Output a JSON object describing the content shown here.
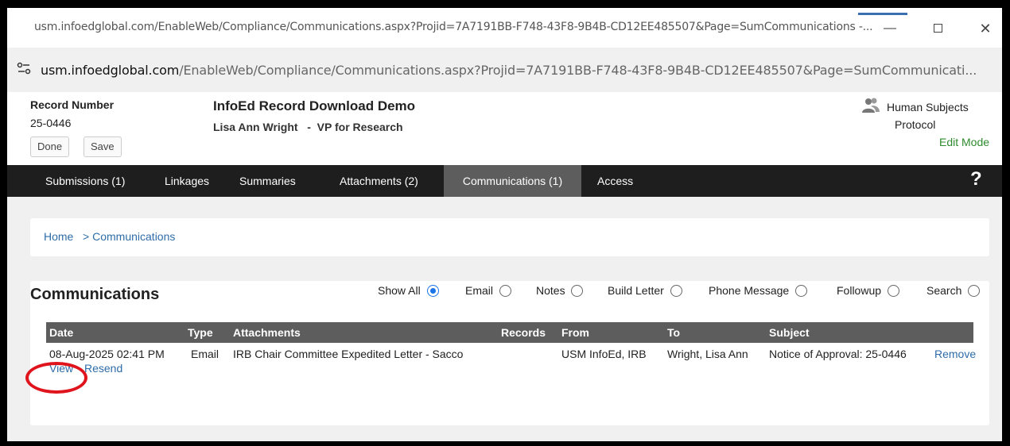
{
  "window": {
    "title_url": "usm.infoedglobal.com/EnableWeb/Compliance/Communications.aspx?Projid=7A7191BB-F748-43F8-9B4B-CD12EE485507&Page=SumCommunications -...",
    "minimize": "—",
    "close": "✕"
  },
  "address": {
    "host": "usm.infoedglobal.com",
    "path": "/EnableWeb/Compliance/Communications.aspx?Projid=7A7191BB-F748-43F8-9B4B-CD12EE485507&Page=SumCommunicati..."
  },
  "record": {
    "number_label": "Record Number",
    "number": "25-0446",
    "done_label": "Done",
    "save_label": "Save",
    "title": "InfoEd Record Download Demo",
    "person": "Lisa Ann Wright   -  VP for Research",
    "type_line1": "Human Subjects",
    "type_line2": "Protocol",
    "mode": "Edit Mode",
    "type_icon": "people-icon"
  },
  "tabs": [
    {
      "label": "Submissions (1)"
    },
    {
      "label": "Linkages"
    },
    {
      "label": "Summaries"
    },
    {
      "label": "Attachments (2)"
    },
    {
      "label": "Communications (1)"
    },
    {
      "label": "Access"
    }
  ],
  "active_tab": "Communications (1)",
  "help_label": "?",
  "breadcrumb": {
    "home": "Home",
    "separator": ">",
    "current": "Communications"
  },
  "communications": {
    "title": "Communications",
    "filters": [
      {
        "label": "Show All",
        "selected": true
      },
      {
        "label": "Email",
        "selected": false
      },
      {
        "label": "Notes",
        "selected": false
      },
      {
        "label": "Build Letter",
        "selected": false
      },
      {
        "label": "Phone Message",
        "selected": false
      },
      {
        "label": "Followup",
        "selected": false
      },
      {
        "label": "Search",
        "selected": false
      }
    ],
    "columns": [
      "Date",
      "Type",
      "Attachments",
      "Records",
      "From",
      "To",
      "Subject"
    ],
    "rows": [
      {
        "date": "08-Aug-2025 02:41 PM",
        "type": "Email",
        "attachments": "IRB Chair Committee Expedited Letter - Sacco",
        "records": "",
        "from": "USM InfoEd, IRB",
        "to": "Wright, Lisa Ann",
        "subject": "Notice of Approval: 25-0446",
        "remove": "Remove",
        "view": "View",
        "resend": "Resend"
      }
    ]
  },
  "colors": {
    "nav_bg": "#1e1e1e",
    "active_tab_bg": "#5d5d5d",
    "link": "#2e6ca8",
    "edit_mode": "#2e8b2e",
    "annotation": "#e0141c"
  }
}
